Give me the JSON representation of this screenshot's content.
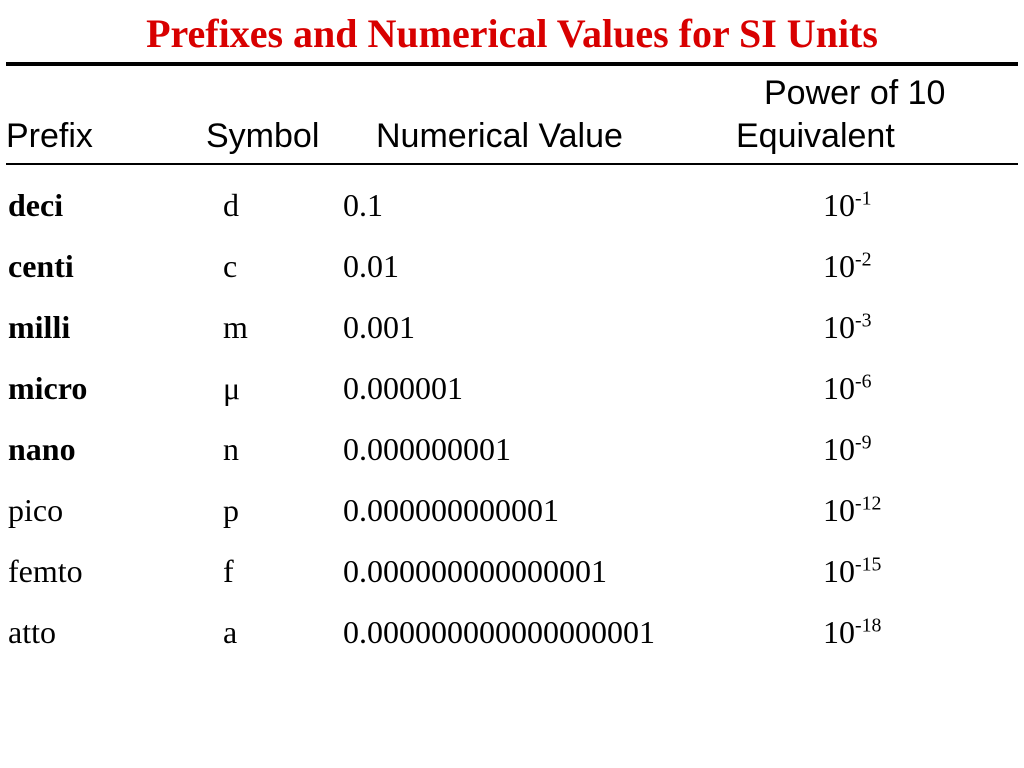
{
  "title": "Prefixes and Numerical Values for SI Units",
  "headers": {
    "prefix": "Prefix",
    "symbol": "Symbol",
    "value": "Numerical Value",
    "power_top": "Power of 10",
    "power_bottom": "Equivalent"
  },
  "chart_data": {
    "type": "table",
    "title": "Prefixes and Numerical Values for SI Units",
    "columns": [
      "Prefix",
      "Symbol",
      "Numerical Value",
      "Power of 10 Equivalent (exponent)"
    ],
    "rows": [
      {
        "prefix": "deci",
        "symbol": "d",
        "value": "0.1",
        "exp": -1,
        "bold": true
      },
      {
        "prefix": "centi",
        "symbol": "c",
        "value": "0.01",
        "exp": -2,
        "bold": true
      },
      {
        "prefix": "milli",
        "symbol": "m",
        "value": "0.001",
        "exp": -3,
        "bold": true
      },
      {
        "prefix": "micro",
        "symbol": "μ",
        "value": "0.000001",
        "exp": -6,
        "bold": true
      },
      {
        "prefix": "nano",
        "symbol": "n",
        "value": "0.000000001",
        "exp": -9,
        "bold": true
      },
      {
        "prefix": "pico",
        "symbol": "p",
        "value": "0.000000000001",
        "exp": -12,
        "bold": false
      },
      {
        "prefix": "femto",
        "symbol": "f",
        "value": "0.000000000000001",
        "exp": -15,
        "bold": false
      },
      {
        "prefix": "atto",
        "symbol": "a",
        "value": "0.000000000000000001",
        "exp": -18,
        "bold": false
      }
    ]
  }
}
